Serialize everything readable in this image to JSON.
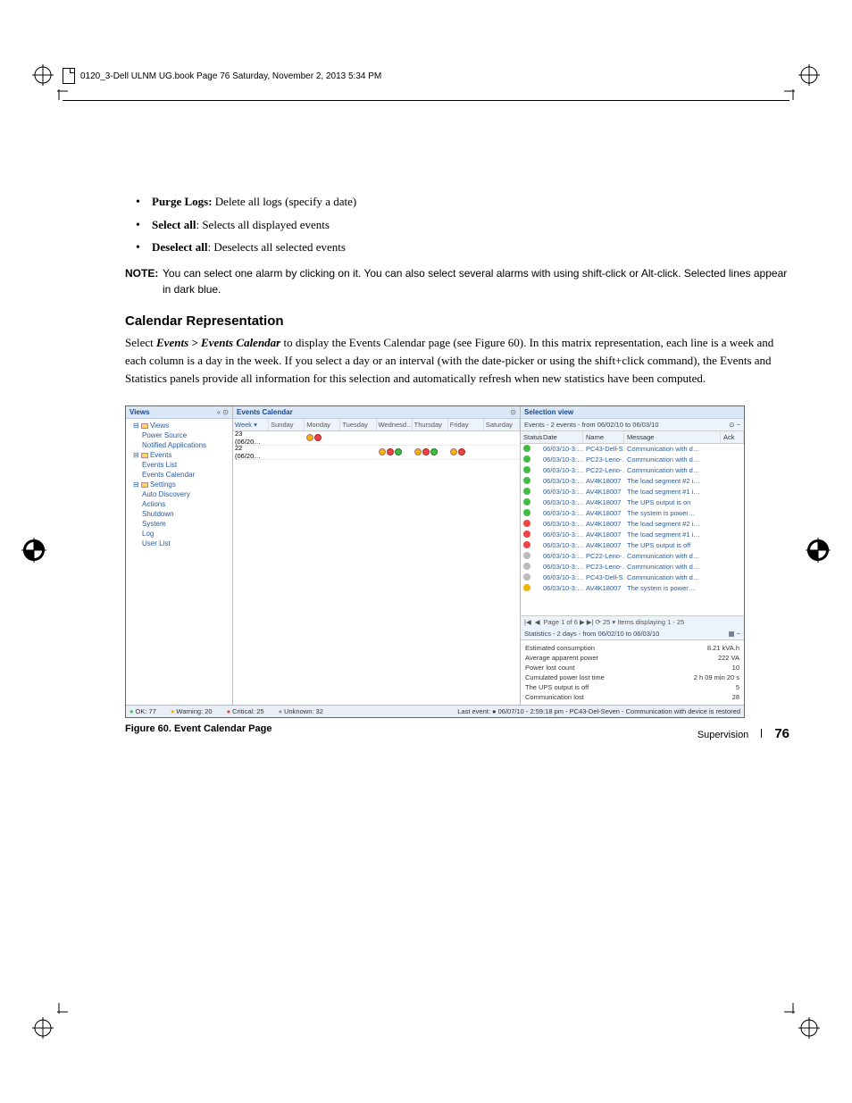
{
  "header_line": "0120_3-Dell ULNM UG.book  Page 76  Saturday, November 2, 2013  5:34 PM",
  "bullets": [
    {
      "lead": "Purge Logs:",
      "rest": " Delete all logs (specify a date)"
    },
    {
      "lead": "Select all",
      "rest": ": Selects all displayed events"
    },
    {
      "lead": "Deselect all",
      "rest": ": Deselects all selected events"
    }
  ],
  "note": {
    "label": "NOTE:",
    "text": "You can select one alarm by clicking on it. You can also select several alarms with using shift-click or Alt-click. Selected lines appear in dark blue."
  },
  "section_heading": "Calendar Representation",
  "body": {
    "pre": "Select ",
    "emph": "Events > Events Calendar",
    "post": " to display the Events Calendar page (see Figure 60). In this matrix representation, each line is a week and each column is a day in the week. If you select a day or an interval (with the date-picker or using the shift+click command), the Events and Statistics panels provide all information for this selection and automatically refresh when new statistics have been computed."
  },
  "figure_caption": "Figure 60.  Event Calendar Page",
  "footer": {
    "section": "Supervision",
    "page": "76"
  },
  "shot": {
    "views_title": "Views",
    "tree": [
      {
        "t": "Views",
        "cls": "blue",
        "icon": true
      },
      {
        "t": "Power Source",
        "cls": "indent1 blue"
      },
      {
        "t": "Notified Applications",
        "cls": "indent1 blue"
      },
      {
        "t": "Events",
        "cls": "blue",
        "icon": true
      },
      {
        "t": "Events List",
        "cls": "indent1 blue"
      },
      {
        "t": "Events Calendar",
        "cls": "indent1 blue"
      },
      {
        "t": "Settings",
        "cls": "blue",
        "icon": true
      },
      {
        "t": "Auto Discovery",
        "cls": "indent1 blue"
      },
      {
        "t": "Actions",
        "cls": "indent1 blue"
      },
      {
        "t": "Shutdown",
        "cls": "indent1 blue"
      },
      {
        "t": "System",
        "cls": "indent1 blue"
      },
      {
        "t": "Log",
        "cls": "indent1 blue"
      },
      {
        "t": "User List",
        "cls": "indent1 blue"
      }
    ],
    "cal_title": "Events Calendar",
    "cal_cols": [
      "Week ▾",
      "Sunday",
      "Monday",
      "Tuesday",
      "Wednesd…",
      "Thursday",
      "Friday",
      "Saturday"
    ],
    "cal_rows": [
      {
        "wk": "23 (06/20…",
        "cells": [
          "",
          "yr",
          "",
          "",
          "",
          "",
          ""
        ]
      },
      {
        "wk": "22 (06/20…",
        "cells": [
          "",
          "",
          "",
          "yr g",
          "yr g",
          "yr",
          ""
        ]
      }
    ],
    "sel_title": "Selection view",
    "ev_sub": "Events - 2 events - from 06/02/10 to 06/03/10",
    "ev_cols": [
      "Status",
      "Date",
      "Name",
      "Message",
      "Ack"
    ],
    "ev_rows": [
      {
        "s": "g",
        "d": "06/03/10-3:…",
        "n": "PC43-Dell-S…",
        "m": "Communication with d…"
      },
      {
        "s": "g",
        "d": "06/03/10-3:…",
        "n": "PC23-Leno-…",
        "m": "Communication with d…"
      },
      {
        "s": "g",
        "d": "06/03/10-3:…",
        "n": "PC22-Leno-…",
        "m": "Communication with d…"
      },
      {
        "s": "g",
        "d": "06/03/10-3:…",
        "n": "AV4K18007",
        "m": "The load segment #2 i…"
      },
      {
        "s": "g",
        "d": "06/03/10-3:…",
        "n": "AV4K18007",
        "m": "The load segment #1 i…"
      },
      {
        "s": "g",
        "d": "06/03/10-3:…",
        "n": "AV4K18007",
        "m": "The UPS output is on"
      },
      {
        "s": "g",
        "d": "06/03/10-3:…",
        "n": "AV4K18007",
        "m": "The system is power…"
      },
      {
        "s": "r",
        "d": "06/03/10-3:…",
        "n": "AV4K18007",
        "m": "The load segment #2 i…"
      },
      {
        "s": "r",
        "d": "06/03/10-3:…",
        "n": "AV4K18007",
        "m": "The load segment #1 i…"
      },
      {
        "s": "r",
        "d": "06/03/10-3:…",
        "n": "AV4K18007",
        "m": "The UPS output is off"
      },
      {
        "s": "gy",
        "d": "06/03/10-3:…",
        "n": "PC22-Leno-…",
        "m": "Communication with d…"
      },
      {
        "s": "gy",
        "d": "06/03/10-3:…",
        "n": "PC23-Leno-…",
        "m": "Communication with d…"
      },
      {
        "s": "gy",
        "d": "06/03/10-3:…",
        "n": "PC43-Dell-S…",
        "m": "Communication with d…"
      },
      {
        "s": "y",
        "d": "06/03/10-3:…",
        "n": "AV4K18007",
        "m": "The system is power…"
      }
    ],
    "pager": "Page 1   of 6   ▶  ▶|   ⟳  25 ▾ Items displaying 1 - 25",
    "stat_sub": "Statistics - 2 days - from 06/02/10 to 06/03/10",
    "stats": [
      {
        "l": "Estimated consumption",
        "v": "8.21 kVA.h"
      },
      {
        "l": "Average apparent power",
        "v": "222 VA"
      },
      {
        "l": "Power lost count",
        "v": "10"
      },
      {
        "l": "Cumulated power lost time",
        "v": "2 h 09 min 20 s"
      },
      {
        "l": "The UPS output is off",
        "v": "5"
      },
      {
        "l": "Communication lost",
        "v": "28"
      }
    ],
    "statusbar": {
      "ok": "OK: 77",
      "warn": "Warning: 20",
      "crit": "Critical: 25",
      "unk": "Unknown: 32",
      "last": "Last event:   ●  06/07/10 - 2:59:18 pm - PC43-Del-Seven - Communication with device is restored"
    }
  }
}
